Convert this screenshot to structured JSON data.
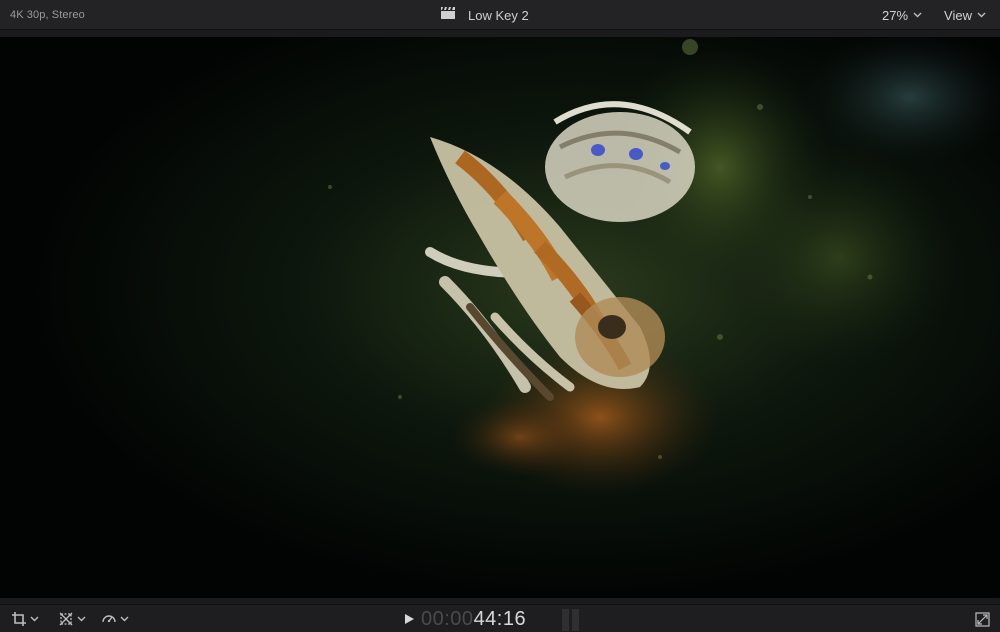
{
  "header": {
    "format": "4K 30p, Stereo",
    "project_title": "Low Key 2",
    "zoom_label": "27%",
    "view_label": "View"
  },
  "icons": {
    "clapper": "clapperboard-icon",
    "crop": "crop-icon",
    "transform": "transform-icon",
    "retime": "speedometer-icon",
    "play": "play-icon",
    "fullscreen": "fullscreen-icon"
  },
  "timecode": {
    "dim": "00:00",
    "bright": "44:16"
  },
  "colors": {
    "background": "#1b1b1d",
    "viewer_bg": "#030504",
    "accent_text": "#d8d8d8",
    "dim_text": "#4a4a4c"
  }
}
